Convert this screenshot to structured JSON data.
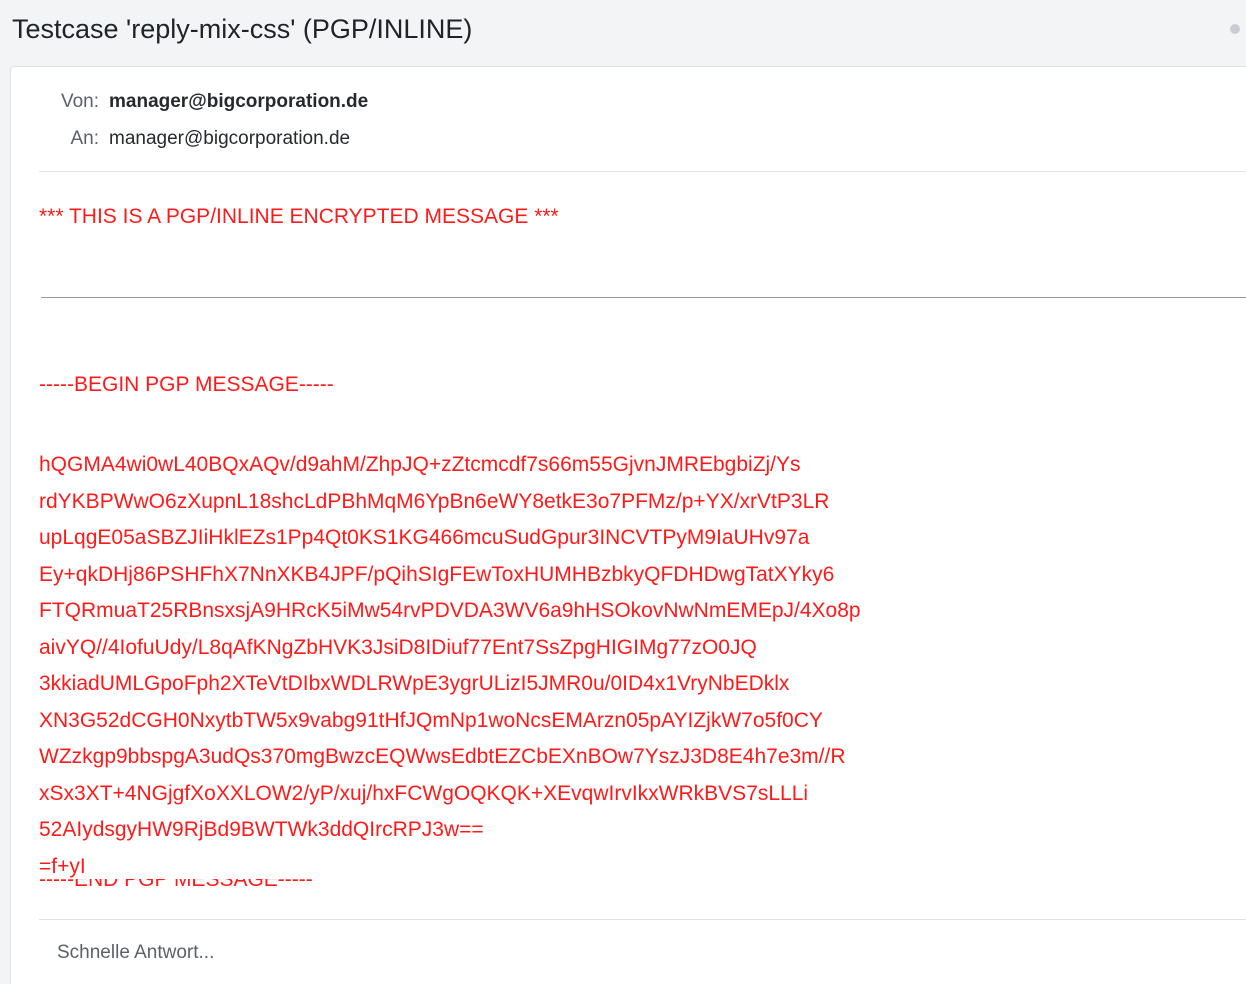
{
  "window": {
    "subject": "Testcase 'reply-mix-css' (PGP/INLINE)"
  },
  "headers": {
    "from_label": "Von:",
    "from_value": "manager@bigcorporation.de",
    "to_label": "An:",
    "to_value": "manager@bigcorporation.de"
  },
  "message": {
    "banner": "*** THIS IS A PGP/INLINE ENCRYPTED MESSAGE ***",
    "pgp_begin": "-----BEGIN PGP MESSAGE-----",
    "pgp_lines": [
      "hQGMA4wi0wL40BQxAQv/d9ahM/ZhpJQ+zZtcmcdf7s66m55GjvnJMREbgbiZj/Ys",
      "rdYKBPWwO6zXupnL18shcLdPBhMqM6YpBn6eWY8etkE3o7PFMz/p+YX/xrVtP3LR",
      "upLqgE05aSBZJIiHklEZs1Pp4Qt0KS1KG466mcuSudGpur3INCVTPyM9IaUHv97a",
      "Ey+qkDHj86PSHFhX7NnXKB4JPF/pQihSIgFEwToxHUMHBzbkyQFDHDwgTatXYky6",
      "FTQRmuaT25RBnsxsjA9HRcK5iMw54rvPDVDA3WV6a9hHSOkovNwNmEMEpJ/4Xo8p",
      "aivYQ//4IofuUdy/L8qAfKNgZbHVK3JsiD8IDiuf77Ent7SsZpgHIGIMg77zO0JQ",
      "3kkiadUMLGpoFph2XTeVtDIbxWDLRWpE3ygrULizI5JMR0u/0ID4x1VryNbEDklx",
      "XN3G52dCGH0NxytbTW5x9vabg91tHfJQmNp1woNcsEMArzn05pAYIZjkW7o5f0CY",
      "WZzkgp9bbspgA3udQs370mgBwzcEQWwsEdbtEZCbEXnBOw7YszJ3D8E4h7e3m//R",
      "xSx3XT+4NGjgfXoXXLOW2/yP/xuj/hxFCWgOQKQK+XEvqwIrvIkxWRkBVS7sLLLi",
      "52AIydsgyHW9RjBd9BWTWk3ddQIrcRPJ3w==",
      "=f+yI"
    ],
    "pgp_end": "-----END PGP MESSAGE-----"
  },
  "quick_reply": {
    "placeholder": "Schnelle Antwort..."
  },
  "colors": {
    "message_text": "#ff1a1a",
    "background": "#f2f4f6",
    "card": "#ffffff"
  }
}
